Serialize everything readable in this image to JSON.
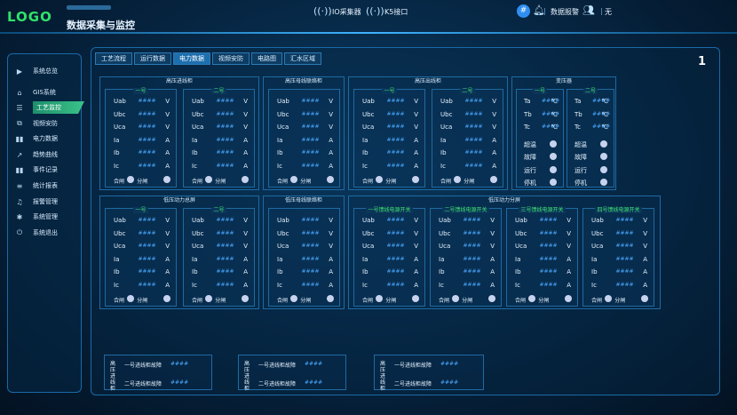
{
  "header": {
    "logo": "LOGO",
    "title": "数据采集与监控",
    "io_label": "IO采集器",
    "k5_label": "K5接口",
    "hash": "#",
    "alarm": "数据报警",
    "sep": "|",
    "user_status": "无"
  },
  "sidebar": {
    "items": [
      {
        "label": "系统总览",
        "icon": "play-square-icon"
      },
      {
        "label": "GIS系统",
        "icon": "home-icon"
      },
      {
        "label": "工艺监控",
        "icon": "list-icon",
        "active": true
      },
      {
        "label": "视频安防",
        "icon": "network-icon"
      },
      {
        "label": "电力数据",
        "icon": "bar-chart-icon"
      },
      {
        "label": "趋势曲线",
        "icon": "trend-icon"
      },
      {
        "label": "事件记录",
        "icon": "bar-chart-icon"
      },
      {
        "label": "统计报表",
        "icon": "menu-icon"
      },
      {
        "label": "报警管理",
        "icon": "bell-icon"
      },
      {
        "label": "系统管理",
        "icon": "gear-icon"
      },
      {
        "label": "系统退出",
        "icon": "power-icon"
      }
    ]
  },
  "page_number": "1",
  "tabs": [
    "工艺流程",
    "运行数据",
    "电力数据",
    "视频安防",
    "电路图",
    "汇水区域"
  ],
  "active_tab": 2,
  "placeholder": "####",
  "groups": {
    "hv_in": "高压进线柜",
    "hv_bus": "高压母线联络柜",
    "hv_out": "高压出线柜",
    "transformer": "变压器",
    "lv_main": "低压动力总屏",
    "lv_bus": "低压母线联络柜",
    "lv_dist": "低压动力分屏"
  },
  "cabinets": {
    "no1": "一号",
    "no2": "二号",
    "lv1": "一号馈线电源开关",
    "lv2": "二号馈线电源开关",
    "lv3": "三号馈线电源开关",
    "lv4": "四号馈线电源开关"
  },
  "elec_rows": [
    {
      "k": "Uab",
      "u": "V"
    },
    {
      "k": "Ubc",
      "u": "V"
    },
    {
      "k": "Uca",
      "u": "V"
    },
    {
      "k": "Ia",
      "u": "A"
    },
    {
      "k": "Ib",
      "u": "A"
    },
    {
      "k": "Ic",
      "u": "A"
    }
  ],
  "states": {
    "close": "合闸",
    "open": "分闸"
  },
  "transformer_rows": [
    {
      "k": "Ta",
      "u": "℃"
    },
    {
      "k": "Tb",
      "u": "℃"
    },
    {
      "k": "Tc",
      "u": "℃"
    }
  ],
  "transformer_flags": [
    "超温",
    "故障",
    "运行",
    "停机"
  ],
  "bottom": {
    "vlabel": "高压进线柜",
    "line1": "一号进线柜故障",
    "line2": "二号进线柜故障"
  }
}
